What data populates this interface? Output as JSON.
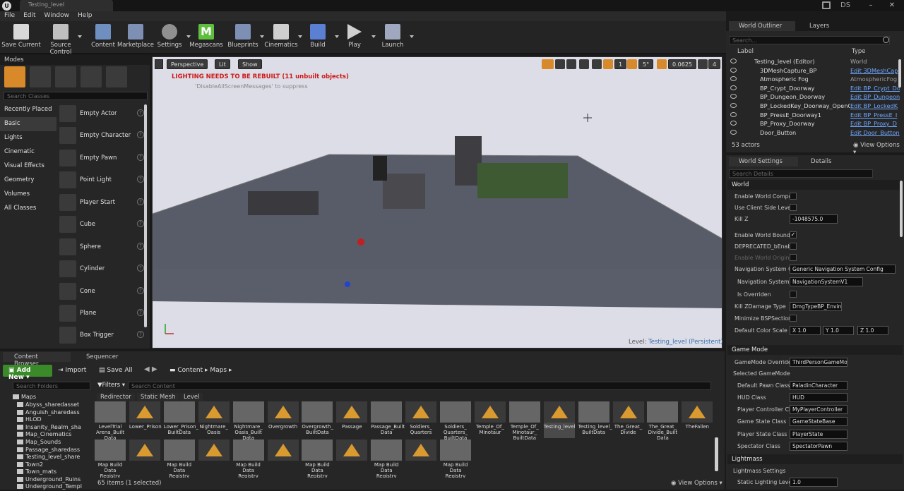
{
  "window": {
    "tab_title": "Testing_level",
    "user": "DS"
  },
  "menu": [
    "File",
    "Edit",
    "Window",
    "Help"
  ],
  "toolbar": [
    {
      "label": "Save Current",
      "icon": "save-icon"
    },
    {
      "label": "Source Control",
      "icon": "source-control-icon"
    },
    {
      "label": "Content",
      "icon": "content-icon"
    },
    {
      "label": "Marketplace",
      "icon": "marketplace-icon"
    },
    {
      "label": "Settings",
      "icon": "settings-icon"
    },
    {
      "label": "Megascans",
      "icon": "megascans-icon"
    },
    {
      "label": "Blueprints",
      "icon": "blueprints-icon"
    },
    {
      "label": "Cinematics",
      "icon": "cinematics-icon"
    },
    {
      "label": "Build",
      "icon": "build-icon"
    },
    {
      "label": "Play",
      "icon": "play-icon"
    },
    {
      "label": "Launch",
      "icon": "launch-icon"
    }
  ],
  "modes": {
    "title": "Modes",
    "search_placeholder": "Search Classes",
    "categories": [
      "Recently Placed",
      "Basic",
      "Lights",
      "Cinematic",
      "Visual Effects",
      "Geometry",
      "Volumes",
      "All Classes"
    ],
    "selected_category": "Basic",
    "items": [
      "Empty Actor",
      "Empty Character",
      "Empty Pawn",
      "Point Light",
      "Player Start",
      "Cube",
      "Sphere",
      "Cylinder",
      "Cone",
      "Plane",
      "Box Trigger"
    ]
  },
  "viewport": {
    "perspective": "Perspective",
    "lit": "Lit",
    "show": "Show",
    "warning": "LIGHTING NEEDS TO BE REBUILT (11 unbuilt objects)",
    "hint": "'DisableAllScreenMessages' to suppress",
    "snap_grid": "1",
    "snap_angle": "5°",
    "snap_scale": "0.0625",
    "camera_speed": "4",
    "level_label": "Level:",
    "level_name": "Testing_level (Persistent)"
  },
  "outliner": {
    "tabs": [
      "World Outliner",
      "Layers"
    ],
    "search_placeholder": "Search...",
    "col_label": "Label",
    "col_type": "Type",
    "rows": [
      {
        "name": "Testing_level (Editor)",
        "type": "World"
      },
      {
        "name": "3DMeshCapture_BP",
        "type": "Edit 3DMeshCap"
      },
      {
        "name": "Atmospheric Fog",
        "type": "AtmosphericFog"
      },
      {
        "name": "BP_Crypt_Doorway",
        "type": "Edit BP_Crypt_Do"
      },
      {
        "name": "BP_Dungeon_Doorway",
        "type": "Edit BP_Dungeon"
      },
      {
        "name": "BP_LockedKey_Doorway_OpenClos",
        "type": "Edit BP_LockedK"
      },
      {
        "name": "BP_PressE_Doorway1",
        "type": "Edit BP_PressE_I"
      },
      {
        "name": "BP_Proxy_Doorway",
        "type": "Edit BP_Proxy_D"
      },
      {
        "name": "Door_Button",
        "type": "Edit Door_Button"
      }
    ],
    "count": "53 actors",
    "view_options": "View Options"
  },
  "details": {
    "tabs": [
      "World Settings",
      "Details"
    ],
    "search_placeholder": "Search Details",
    "world": "World",
    "props": [
      {
        "label": "Enable World Composi",
        "kind": "check",
        "checked": false
      },
      {
        "label": "Use Client Side Level S",
        "kind": "check",
        "checked": false
      },
      {
        "label": "Kill Z",
        "kind": "value",
        "value": "-1048575.0"
      },
      {
        "label": "Enable World Bounds C",
        "kind": "check",
        "checked": true
      },
      {
        "label": "DEPRECATED_bEnable",
        "kind": "check",
        "checked": false
      },
      {
        "label": "Enable World Origin Re",
        "kind": "check",
        "checked": false
      }
    ],
    "nav_config_label": "Navigation System Co",
    "nav_config_value": "Generic Navigation System Config",
    "nav_system_label": "Navigation System",
    "nav_system_value": "NavigationSystemV1",
    "is_overriden": "Is Overriden",
    "kill_zdamage_label": "Kill ZDamage Type",
    "kill_zdamage_value": "DmgTypeBP_Enviro",
    "minimize_bsp": "Minimize BSPSection",
    "default_color_scale": "Default Color Scale",
    "x": "1.0",
    "y": "1.0",
    "z": "1.0",
    "game_mode": "Game Mode",
    "gm_override_label": "GameMode Override",
    "gm_override_value": "ThirdPersonGameMo",
    "selected_gm": "Selected GameMode",
    "gm_rows": [
      {
        "label": "Default Pawn Class",
        "value": "PaladinCharacter"
      },
      {
        "label": "HUD Class",
        "value": "HUD"
      },
      {
        "label": "Player Controller Cla",
        "value": "MyPlayerController"
      },
      {
        "label": "Game State Class",
        "value": "GameStateBase"
      },
      {
        "label": "Player State Class",
        "value": "PlayerState"
      },
      {
        "label": "Spectator Class",
        "value": "SpectatorPawn"
      }
    ],
    "lightmass": "Lightmass",
    "lightmass_settings": "Lightmass Settings",
    "static_lighting_label": "Static Lighting Level",
    "static_lighting_value": "1.0"
  },
  "content_browser": {
    "tabs": [
      "Content Browser",
      "Sequencer"
    ],
    "add_new": "Add New",
    "import": "Import",
    "save_all": "Save All",
    "path": [
      "Content",
      "Maps"
    ],
    "folder_search": "Search Folders",
    "filters": "Filters",
    "content_search": "Search Content",
    "filter_chips": [
      "Redirector",
      "Static Mesh",
      "Level"
    ],
    "folders": [
      "Maps",
      "Abyss_sharedasset",
      "Anguish_sharedass",
      "HLOD",
      "Insanity_Realm_sha",
      "Map_Cinematics",
      "Map_Sounds",
      "Passage_sharedass",
      "Testing_level_share",
      "Town2",
      "Town_mats",
      "Underground_Ruins",
      "Underground_Templ"
    ],
    "assets_row1": [
      {
        "name": "LevelTrial Arena_Built Data",
        "kind": "reg"
      },
      {
        "name": "Lower_Prison",
        "kind": "map"
      },
      {
        "name": "Lower_Prison_ BuiltData",
        "kind": "reg"
      },
      {
        "name": "Nightmare_ Oasis",
        "kind": "map"
      },
      {
        "name": "Nightmare_ Oasis_Built Data",
        "kind": "reg"
      },
      {
        "name": "Overgrowth",
        "kind": "map"
      },
      {
        "name": "Overgrowth_ BuiltData",
        "kind": "reg"
      },
      {
        "name": "Passage",
        "kind": "map"
      },
      {
        "name": "Passage_Built Data",
        "kind": "reg"
      },
      {
        "name": "Soldiers_ Quarters",
        "kind": "map"
      },
      {
        "name": "Soldiers_ Quarters_ BuiltData",
        "kind": "reg"
      },
      {
        "name": "Temple_Of_ Minotaur",
        "kind": "map"
      },
      {
        "name": "Temple_Of_ Minotaur_ BuiltData",
        "kind": "reg"
      },
      {
        "name": "Testing_level",
        "kind": "map"
      },
      {
        "name": "Testing_level_ BuiltData",
        "kind": "reg"
      },
      {
        "name": "The_Great_ Divide",
        "kind": "map"
      },
      {
        "name": "The_Great_ Divide_Built Data",
        "kind": "reg"
      },
      {
        "name": "TheFallen",
        "kind": "map"
      }
    ],
    "assets_row2": [
      {
        "name": "Map Build Data Registry",
        "kind": "reg"
      },
      {
        "name": "",
        "kind": "map"
      },
      {
        "name": "Map Build Data Registry",
        "kind": "reg"
      },
      {
        "name": "",
        "kind": "map"
      },
      {
        "name": "Map Build Data Registry",
        "kind": "reg"
      },
      {
        "name": "",
        "kind": "map"
      },
      {
        "name": "Map Build Data Registry",
        "kind": "reg"
      },
      {
        "name": "",
        "kind": "map"
      },
      {
        "name": "Map Build Data Registry",
        "kind": "reg"
      },
      {
        "name": "",
        "kind": "map"
      },
      {
        "name": "Map Build Data Registry",
        "kind": "reg"
      }
    ],
    "status": "65 items (1 selected)",
    "view_options": "View Options"
  }
}
